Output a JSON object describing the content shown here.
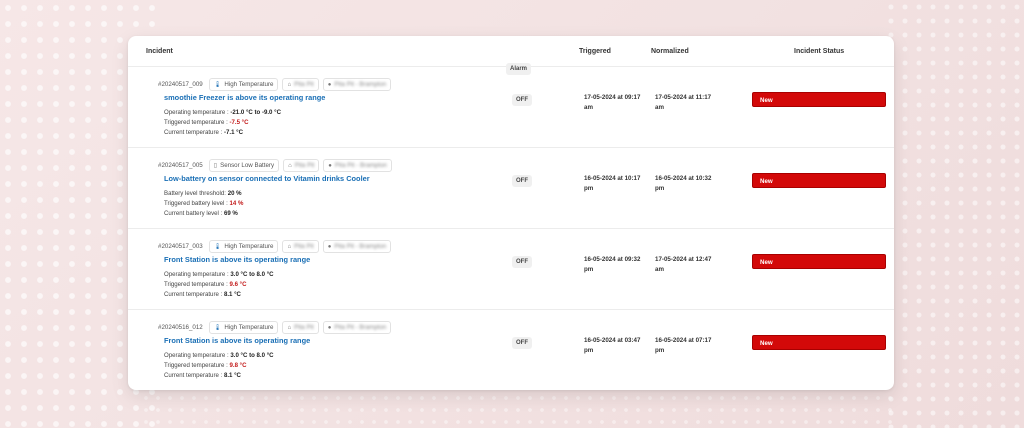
{
  "table": {
    "headers": {
      "incident": "Incident",
      "alarm": "Alarm",
      "triggered": "Triggered",
      "normalized": "Normalized",
      "status": "Incident Status"
    }
  },
  "rows": [
    {
      "ref": "#20240517_009",
      "type_label": "High Temperature",
      "type_icon": "thermometer-icon",
      "org_blurred": "Pita Pit",
      "location_blurred": "Pita Pit - Brampton",
      "title": "smoothie Freezer is above its operating range",
      "line1_label": "Operating temperature : ",
      "line1_value": "-21.0 °C to -9.0 °C",
      "line2_label": "Triggered temperature : ",
      "line2_value": "-7.5 °C",
      "line3_label": "Current temperature : ",
      "line3_value": "-7.1 °C",
      "alarm": "OFF",
      "triggered": "17-05-2024 at 09:17 am",
      "normalized": "17-05-2024 at 11:17 am",
      "status": "New"
    },
    {
      "ref": "#20240517_005",
      "type_label": "Sensor Low Battery",
      "type_icon": "battery-icon",
      "org_blurred": "Pita Pit",
      "location_blurred": "Pita Pit - Brampton",
      "title": "Low-battery on sensor connected to Vitamin drinks Cooler",
      "line1_label": "Battery level threshold: ",
      "line1_value": "20 %",
      "line2_label": "Triggered battery level : ",
      "line2_value": "14 %",
      "line3_label": "Current battery level : ",
      "line3_value": "69 %",
      "alarm": "OFF",
      "triggered": "16-05-2024 at 10:17 pm",
      "normalized": "16-05-2024 at 10:32 pm",
      "status": "New"
    },
    {
      "ref": "#20240517_003",
      "type_label": "High Temperature",
      "type_icon": "thermometer-icon",
      "org_blurred": "Pita Pit",
      "location_blurred": "Pita Pit - Brampton",
      "title": "Front Station is above its operating range",
      "line1_label": "Operating temperature : ",
      "line1_value": "3.0 °C to 8.0 °C",
      "line2_label": "Triggered temperature : ",
      "line2_value": "9.6 °C",
      "line3_label": "Current temperature : ",
      "line3_value": "8.1 °C",
      "alarm": "OFF",
      "triggered": "16-05-2024 at 09:32 pm",
      "normalized": "17-05-2024 at 12:47 am",
      "status": "New"
    },
    {
      "ref": "#20240516_012",
      "type_label": "High Temperature",
      "type_icon": "thermometer-icon",
      "org_blurred": "Pita Pit",
      "location_blurred": "Pita Pit - Brampton",
      "title": "Front Station is above its operating range",
      "line1_label": "Operating temperature : ",
      "line1_value": "3.0 °C to 8.0 °C",
      "line2_label": "Triggered temperature : ",
      "line2_value": "9.8 °C",
      "line3_label": "Current temperature : ",
      "line3_value": "8.1 °C",
      "alarm": "OFF",
      "triggered": "16-05-2024 at 03:47 pm",
      "normalized": "16-05-2024 at 07:17 pm",
      "status": "New"
    }
  ],
  "colors": {
    "link": "#1a6fb5",
    "alert_value": "#c21a1a",
    "status_new_bg": "#d30909"
  }
}
